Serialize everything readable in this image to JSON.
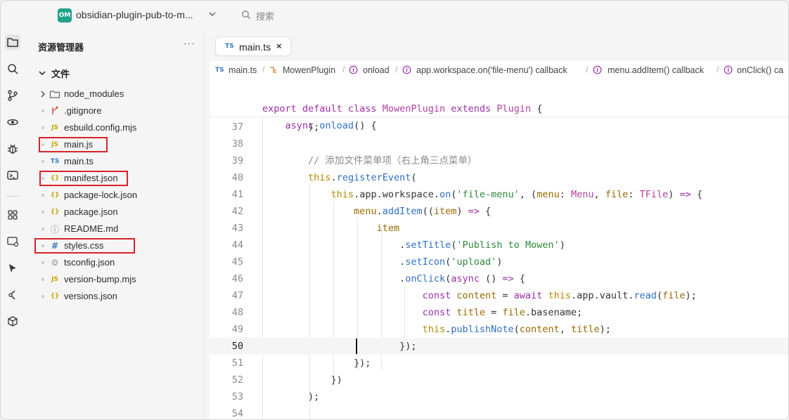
{
  "topbar": {
    "project_badge": "OM",
    "project_name": "obsidian-plugin-pub-to-m...",
    "search_placeholder": "搜索"
  },
  "activity_icons": [
    "files-icon",
    "search-icon",
    "source-control-icon",
    "extensions-icon",
    "debug-icon",
    "terminal-icon",
    "apps-icon",
    "remote-icon",
    "cursor-pointer-icon",
    "git-graph-icon",
    "package-icon"
  ],
  "sidebar": {
    "title": "资源管理器",
    "more": "···",
    "section": "文件",
    "items": [
      {
        "name": "node_modules",
        "icon": "folder-icon",
        "kind": "folder"
      },
      {
        "name": ".gitignore",
        "icon": "git-icon",
        "kind": "file"
      },
      {
        "name": "esbuild.config.mjs",
        "icon": "js-icon",
        "badge": "JS",
        "kind": "file"
      },
      {
        "name": "main.js",
        "icon": "js-icon",
        "badge": "JS",
        "kind": "file",
        "highlighted": true
      },
      {
        "name": "main.ts",
        "icon": "ts-icon",
        "badge": "TS",
        "kind": "file"
      },
      {
        "name": "manifest.json",
        "icon": "json-icon",
        "badge": "{}",
        "kind": "file",
        "highlighted": true
      },
      {
        "name": "package-lock.json",
        "icon": "json-icon",
        "badge": "{}",
        "kind": "file"
      },
      {
        "name": "package.json",
        "icon": "json-icon",
        "badge": "{}",
        "kind": "file"
      },
      {
        "name": "README.md",
        "icon": "info-icon",
        "badge": "ⓘ",
        "kind": "file"
      },
      {
        "name": "styles.css",
        "icon": "css-icon",
        "badge": "#",
        "kind": "file",
        "highlighted": true
      },
      {
        "name": "tsconfig.json",
        "icon": "gear-icon",
        "badge": "⚙",
        "kind": "file"
      },
      {
        "name": "version-bump.mjs",
        "icon": "js-icon",
        "badge": "JS",
        "kind": "file"
      },
      {
        "name": "versions.json",
        "icon": "json-icon",
        "badge": "{}",
        "kind": "file"
      }
    ]
  },
  "editor": {
    "tab": {
      "badge": "TS",
      "label": "main.ts",
      "close": "×"
    },
    "breadcrumbs": [
      {
        "badge": "TS",
        "label": "main.ts"
      },
      {
        "label": "MowenPlugin"
      },
      {
        "label": "onload"
      },
      {
        "label": "app.workspace.on('file-menu') callback"
      },
      {
        "label": "menu.addItem() callback"
      },
      {
        "label": "onClick() ca"
      }
    ],
    "sticky_lines": [
      "export default class MowenPlugin extends Plugin {",
      "    async onload() {"
    ],
    "lines": [
      {
        "n": "37",
        "code": "        );"
      },
      {
        "n": "38",
        "code": ""
      },
      {
        "n": "39",
        "code": "        // 添加文件菜单项（右上角三点菜单）"
      },
      {
        "n": "40",
        "code": "        this.registerEvent("
      },
      {
        "n": "41",
        "code": "            this.app.workspace.on('file-menu', (menu: Menu, file: TFile) => {"
      },
      {
        "n": "42",
        "code": "                menu.addItem((item) => {"
      },
      {
        "n": "43",
        "code": "                    item"
      },
      {
        "n": "44",
        "code": "                        .setTitle('Publish to Mowen')"
      },
      {
        "n": "45",
        "code": "                        .setIcon('upload')"
      },
      {
        "n": "46",
        "code": "                        .onClick(async () => {"
      },
      {
        "n": "47",
        "code": "                            const content = await this.app.vault.read(file);"
      },
      {
        "n": "48",
        "code": "                            const title = file.basename;"
      },
      {
        "n": "49",
        "code": "                            this.publishNote(content, title);"
      },
      {
        "n": "50",
        "code": "                        });"
      },
      {
        "n": "51",
        "code": "                });"
      },
      {
        "n": "52",
        "code": "            })"
      },
      {
        "n": "53",
        "code": "        );"
      },
      {
        "n": "54",
        "code": ""
      }
    ],
    "current_line": "50"
  },
  "colors": {
    "accent": "#1fa38a",
    "highlight_box": "#d8232a",
    "keyword": "#9a2fa6",
    "function": "#2f6fc7",
    "string": "#2f8a3a"
  }
}
